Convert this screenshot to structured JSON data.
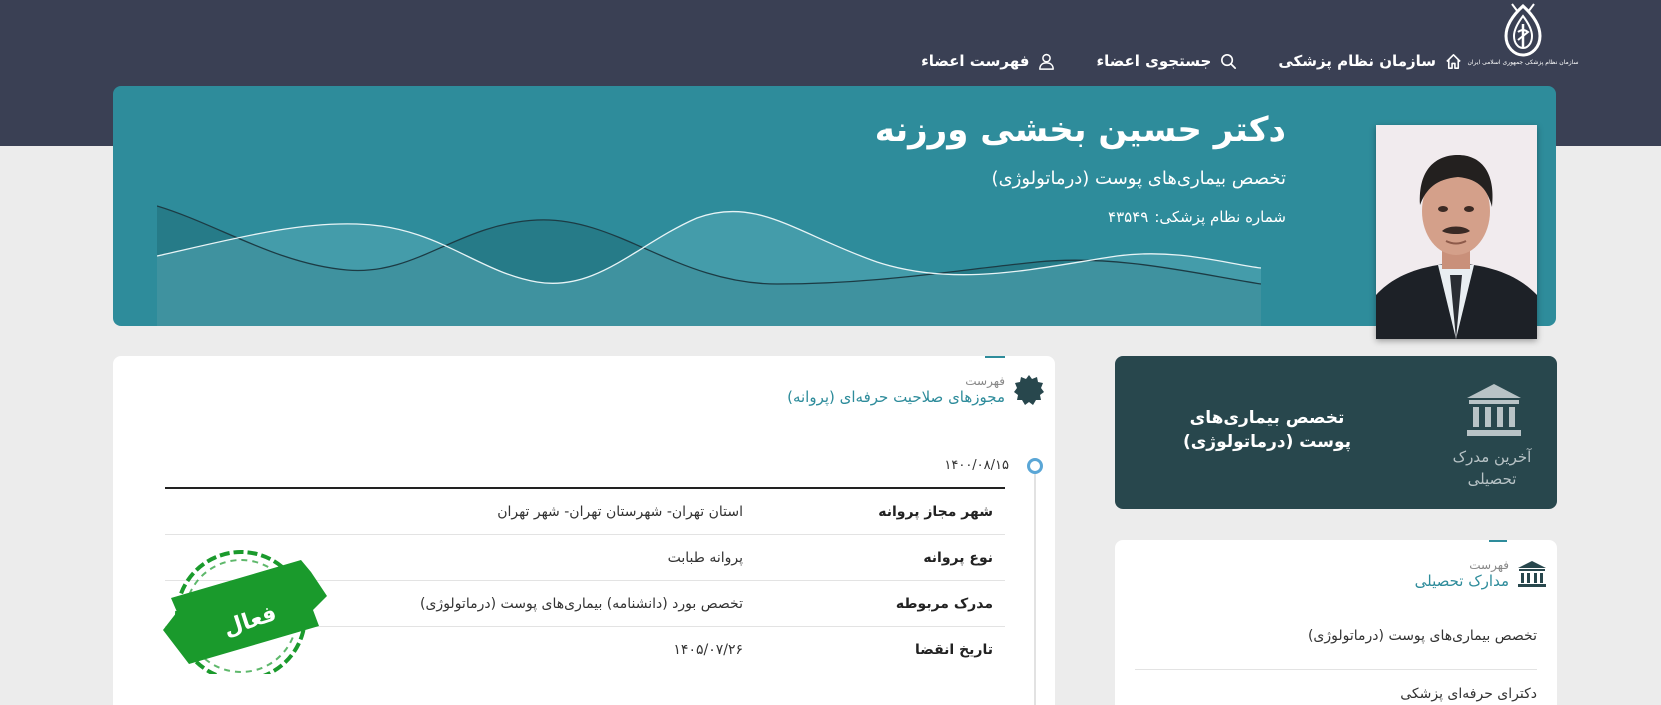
{
  "header": {
    "logo_text": "سازمان نظام پزشکی جمهوری اسلامی ایران",
    "nav": [
      {
        "label": "سازمان نظام پزشکی",
        "icon": "home-icon"
      },
      {
        "label": "جستجوی اعضاء",
        "icon": "search-icon"
      },
      {
        "label": "فهرست اعضاء",
        "icon": "user-icon"
      }
    ]
  },
  "profile": {
    "name": "دکتر حسین بخشی ورزنه",
    "specialty": "تخصص بیماری‌های پوست (درماتولوژی)",
    "number_label": "شماره نظام پزشکی:",
    "number_value": "۴۳۵۴۹"
  },
  "latest_degree": {
    "label": "آخرین مدرک تحصیلی",
    "value": "تخصص بیماری‌های پوست (درماتولوژی)"
  },
  "education": {
    "sub": "فهرست",
    "title": "مدارک تحصیلی",
    "items": [
      "تخصص بیماری‌های پوست (درماتولوژی)",
      "دکترای حرفه‌ای پزشکی"
    ]
  },
  "licenses": {
    "sub": "فهرست",
    "title": "مجوزهای صلاحیت حرفه‌ای (پروانه)",
    "date": "۱۴۰۰/۰۸/۱۵",
    "rows": [
      {
        "key": "شهر مجاز پروانه",
        "value": "استان تهران- شهرستان تهران- شهر تهران"
      },
      {
        "key": "نوع پروانه",
        "value": "پروانه طبابت"
      },
      {
        "key": "مدرک مربوطه",
        "value": "تخصص بورد (دانشنامه) بیماری‌های پوست (درماتولوژی)"
      },
      {
        "key": "تاریخ انقضا",
        "value": "۱۴۰۵/۰۷/۲۶"
      }
    ],
    "stamp_text": "فعال"
  },
  "colors": {
    "header_bg": "#3a4054",
    "hero_bg": "#2e8c9b",
    "degree_card_bg": "#28474d",
    "accent": "#2e8c9b",
    "stamp_green": "#1a9a2c"
  }
}
